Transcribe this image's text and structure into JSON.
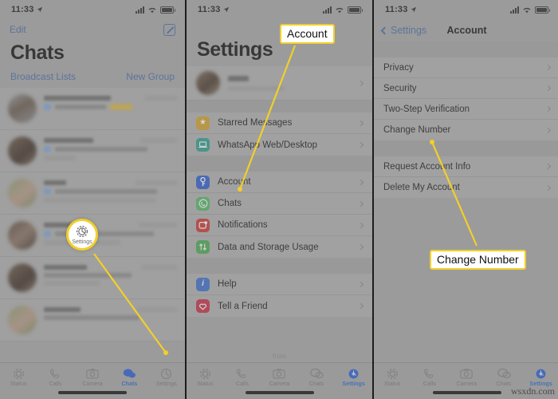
{
  "meta": {
    "watermark": "wsxdn.com"
  },
  "status_bar": {
    "time": "11:33",
    "location_icon": "location-arrow-icon",
    "signal_icon": "signal-bars-icon",
    "wifi_icon": "wifi-icon",
    "battery_icon": "battery-icon"
  },
  "panels": {
    "left": {
      "nav": {
        "edit_label": "Edit",
        "compose_icon": "compose-icon"
      },
      "title": "Chats",
      "sub_left": "Broadcast Lists",
      "sub_right": "New Group",
      "chat_rows": [
        {
          "redacted": true
        },
        {
          "redacted": true
        },
        {
          "redacted": true
        },
        {
          "redacted": true
        },
        {
          "redacted": true
        },
        {
          "redacted": true
        }
      ],
      "tabs": [
        {
          "label": "Status",
          "icon": "status-rings-icon",
          "active": false
        },
        {
          "label": "Calls",
          "icon": "phone-icon",
          "active": false
        },
        {
          "label": "Camera",
          "icon": "camera-icon",
          "active": false
        },
        {
          "label": "Chats",
          "icon": "chat-bubbles-icon",
          "active": true
        },
        {
          "label": "Settings",
          "icon": "gear-icon",
          "active": false
        }
      ]
    },
    "mid": {
      "title": "Settings",
      "profile": {
        "redacted": true,
        "avatar_icon": "profile-avatar"
      },
      "group_1": [
        {
          "label": "Starred Messages",
          "icon": "star-icon",
          "color": "#d4a32c"
        },
        {
          "label": "WhatsApp Web/Desktop",
          "icon": "laptop-icon",
          "color": "#2f9e8f"
        }
      ],
      "group_2": [
        {
          "label": "Account",
          "icon": "key-icon",
          "color": "#2f5fd0"
        },
        {
          "label": "Chats",
          "icon": "whatsapp-icon",
          "color": "#54b964"
        },
        {
          "label": "Notifications",
          "icon": "notification-icon",
          "color": "#cc3b33"
        },
        {
          "label": "Data and Storage Usage",
          "icon": "arrows-updown-icon",
          "color": "#4bab54"
        }
      ],
      "group_3": [
        {
          "label": "Help",
          "icon": "info-icon",
          "color": "#3e6fce"
        },
        {
          "label": "Tell a Friend",
          "icon": "heart-icon",
          "color": "#c9304a"
        }
      ],
      "footer_note": "from",
      "tabs": [
        {
          "label": "Status",
          "icon": "status-rings-icon",
          "active": false
        },
        {
          "label": "Calls",
          "icon": "phone-icon",
          "active": false
        },
        {
          "label": "Camera",
          "icon": "camera-icon",
          "active": false
        },
        {
          "label": "Chats",
          "icon": "chat-bubbles-icon",
          "active": false
        },
        {
          "label": "Settings",
          "icon": "gear-icon",
          "active": true
        }
      ]
    },
    "right": {
      "nav": {
        "back_label": "Settings",
        "back_icon": "chevron-left-icon",
        "title": "Account"
      },
      "group_1": [
        {
          "label": "Privacy"
        },
        {
          "label": "Security"
        },
        {
          "label": "Two-Step Verification"
        },
        {
          "label": "Change Number"
        }
      ],
      "group_2": [
        {
          "label": "Request Account Info"
        },
        {
          "label": "Delete My Account"
        }
      ],
      "tabs": [
        {
          "label": "Status",
          "icon": "status-rings-icon",
          "active": false
        },
        {
          "label": "Calls",
          "icon": "phone-icon",
          "active": false
        },
        {
          "label": "Camera",
          "icon": "camera-icon",
          "active": false
        },
        {
          "label": "Chats",
          "icon": "chat-bubbles-icon",
          "active": false
        },
        {
          "label": "Settings",
          "icon": "gear-icon",
          "active": true
        }
      ]
    }
  },
  "annotations": {
    "accent_color": "#f2cf2a",
    "settings_spotlight": {
      "label": "Settings",
      "icon": "gear-icon"
    },
    "callout_account": "Account",
    "callout_change_number": "Change Number"
  }
}
